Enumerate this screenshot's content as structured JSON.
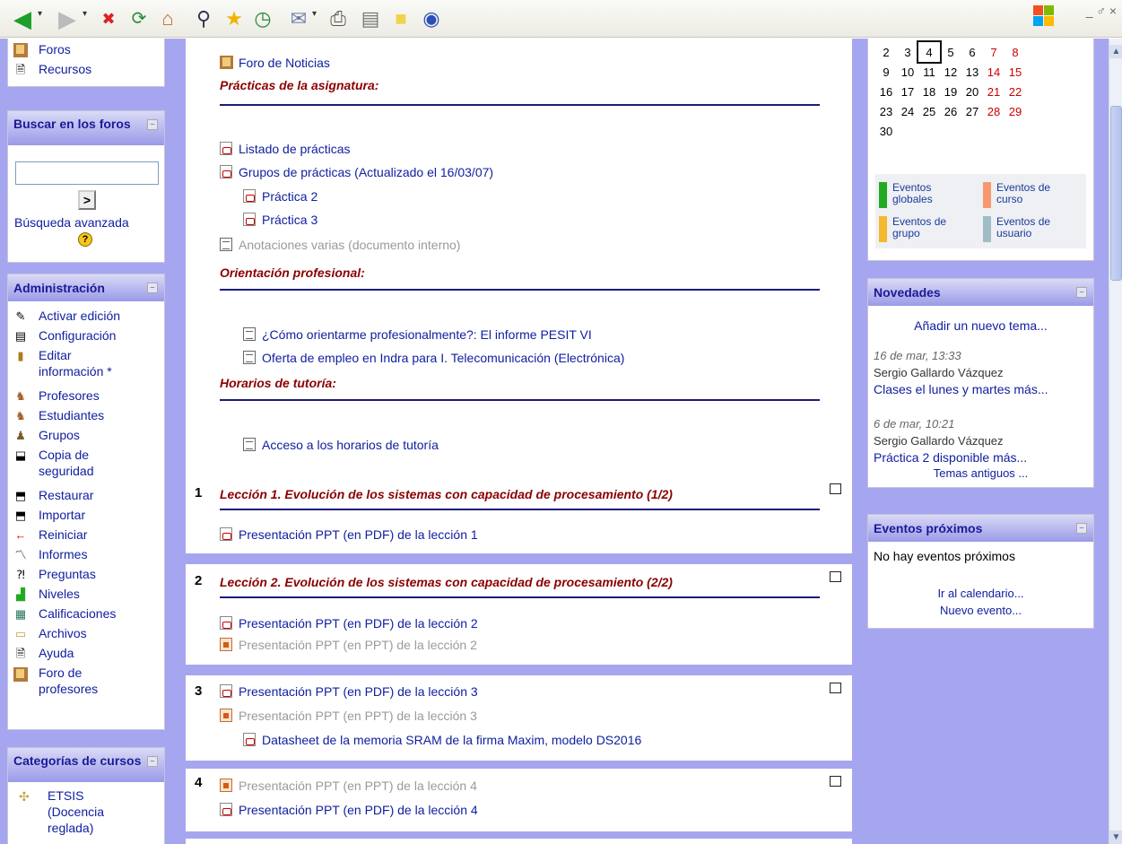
{
  "browser": {
    "toolbar_icons": [
      "back-icon",
      "back-dropdown-icon",
      "forward-icon",
      "forward-dropdown-icon",
      "stop-icon",
      "refresh-icon",
      "home-icon",
      "search-icon",
      "favorites-star-icon",
      "history-icon",
      "mail-icon",
      "mail-dropdown-icon",
      "print-icon",
      "edit-icon",
      "notes-icon",
      "messenger-icon"
    ],
    "window_controls": "_ ♂ ×"
  },
  "left": {
    "top_items": [
      {
        "label": "Foros",
        "icon": "forum-icon"
      },
      {
        "label": "Recursos",
        "icon": "resources-icon"
      }
    ],
    "search": {
      "title": "Buscar en los foros",
      "button": ">",
      "advanced": "Búsqueda avanzada",
      "help": "?"
    },
    "admin": {
      "title": "Administración",
      "items": [
        {
          "label": "Activar edición",
          "icon": "edit-pencil-icon"
        },
        {
          "label": "Configuración",
          "icon": "settings-icon"
        },
        {
          "label": "Editar",
          "label2": "información *",
          "icon": "profile-edit-icon"
        },
        {
          "label": "Profesores",
          "icon": "teachers-icon"
        },
        {
          "label": "Estudiantes",
          "icon": "students-icon"
        },
        {
          "label": "Grupos",
          "icon": "groups-icon"
        },
        {
          "label": "Copia de",
          "label2": "seguridad",
          "icon": "backup-icon"
        },
        {
          "label": "Restaurar",
          "icon": "restore-icon"
        },
        {
          "label": "Importar",
          "icon": "import-icon"
        },
        {
          "label": "Reiniciar",
          "icon": "reset-arrow-icon"
        },
        {
          "label": "Informes",
          "icon": "reports-chart-icon"
        },
        {
          "label": "Preguntas",
          "icon": "questions-icon"
        },
        {
          "label": "Niveles",
          "icon": "scales-icon"
        },
        {
          "label": "Calificaciones",
          "icon": "grades-icon"
        },
        {
          "label": "Archivos",
          "icon": "folder-icon"
        },
        {
          "label": "Ayuda",
          "icon": "help-document-icon"
        },
        {
          "label": "Foro de",
          "label2": "profesores",
          "icon": "forum-icon"
        }
      ]
    },
    "categories": {
      "title": "Categorías de cursos",
      "item": "ETSIS",
      "item2": "(Docencia",
      "item3": "reglada)"
    }
  },
  "main": {
    "top": {
      "foro_noticias": "Foro de Noticias",
      "h_practicas": "Prácticas de la asignatura:",
      "listado": "Listado de prácticas",
      "grupos": "Grupos de prácticas (Actualizado el 16/03/07)",
      "p2": "Práctica 2",
      "p3": "Práctica 3",
      "anotaciones": "Anotaciones varias (documento interno)",
      "h_orientacion": "Orientación profesional:",
      "orient1": "¿Cómo orientarme profesionalmente?: El informe PESIT VI",
      "orient2": "Oferta de empleo en Indra para I. Telecomunicación (Electrónica)",
      "h_horarios": "Horarios de tutoría:",
      "acceso": "Acceso a los horarios de tutoría"
    },
    "sections": [
      {
        "num": "1",
        "title": "Lección 1. Evolución de los sistemas con capacidad de procesamiento (1/2)",
        "rows": [
          {
            "t": "Presentación PPT (en PDF) de la lección 1",
            "kind": "pdf"
          }
        ]
      },
      {
        "num": "2",
        "title": "Lección 2. Evolución de los sistemas con capacidad de procesamiento (2/2)",
        "rows": [
          {
            "t": "Presentación PPT (en PDF) de la lección 2",
            "kind": "pdf"
          },
          {
            "t": "Presentación PPT (en PPT) de la lección 2",
            "kind": "ppt"
          }
        ]
      },
      {
        "num": "3",
        "title": "",
        "rows": [
          {
            "t": "Presentación PPT (en PDF) de la lección 3",
            "kind": "pdf"
          },
          {
            "t": "Presentación PPT (en PPT) de la lección 3",
            "kind": "ppt"
          },
          {
            "t": "Datasheet de la memoria SRAM de la firma Maxim, modelo DS2016",
            "kind": "pdf"
          }
        ]
      },
      {
        "num": "4",
        "title": "",
        "rows": [
          {
            "t": "Presentación PPT (en PPT) de la lección 4",
            "kind": "ppt"
          },
          {
            "t": "Presentación PPT (en PDF) de la lección 4",
            "kind": "pdf"
          }
        ]
      }
    ]
  },
  "right": {
    "calendar": {
      "rows": [
        [
          "2",
          "3",
          "4",
          "5",
          "6",
          "7",
          "8"
        ],
        [
          "9",
          "10",
          "11",
          "12",
          "13",
          "14",
          "15"
        ],
        [
          "16",
          "17",
          "18",
          "19",
          "20",
          "21",
          "22"
        ],
        [
          "23",
          "24",
          "25",
          "26",
          "27",
          "28",
          "29"
        ],
        [
          "30",
          "",
          "",
          "",
          "",
          "",
          ""
        ]
      ],
      "today": "4",
      "legend": [
        {
          "label": "Eventos globales",
          "color": "#22aa22"
        },
        {
          "label": "Eventos de curso",
          "color": "#f7986f"
        },
        {
          "label": "Eventos de grupo",
          "color": "#f5b82e"
        },
        {
          "label": "Eventos de usuario",
          "color": "#9fbcc7"
        }
      ]
    },
    "news": {
      "title": "Novedades",
      "add": "Añadir un nuevo tema...",
      "posts": [
        {
          "date": "16 de mar, 13:33",
          "author": "Sergio Gallardo Vázquez",
          "text": "Clases el lunes y martes más..."
        },
        {
          "date": "6 de mar, 10:21",
          "author": "Sergio Gallardo Vázquez",
          "text": "Práctica 2 disponible más..."
        }
      ],
      "older": "Temas antiguos ..."
    },
    "events": {
      "title": "Eventos próximos",
      "none": "No hay eventos próximos",
      "calendar_link": "Ir al calendario...",
      "new": "Nuevo evento..."
    }
  }
}
